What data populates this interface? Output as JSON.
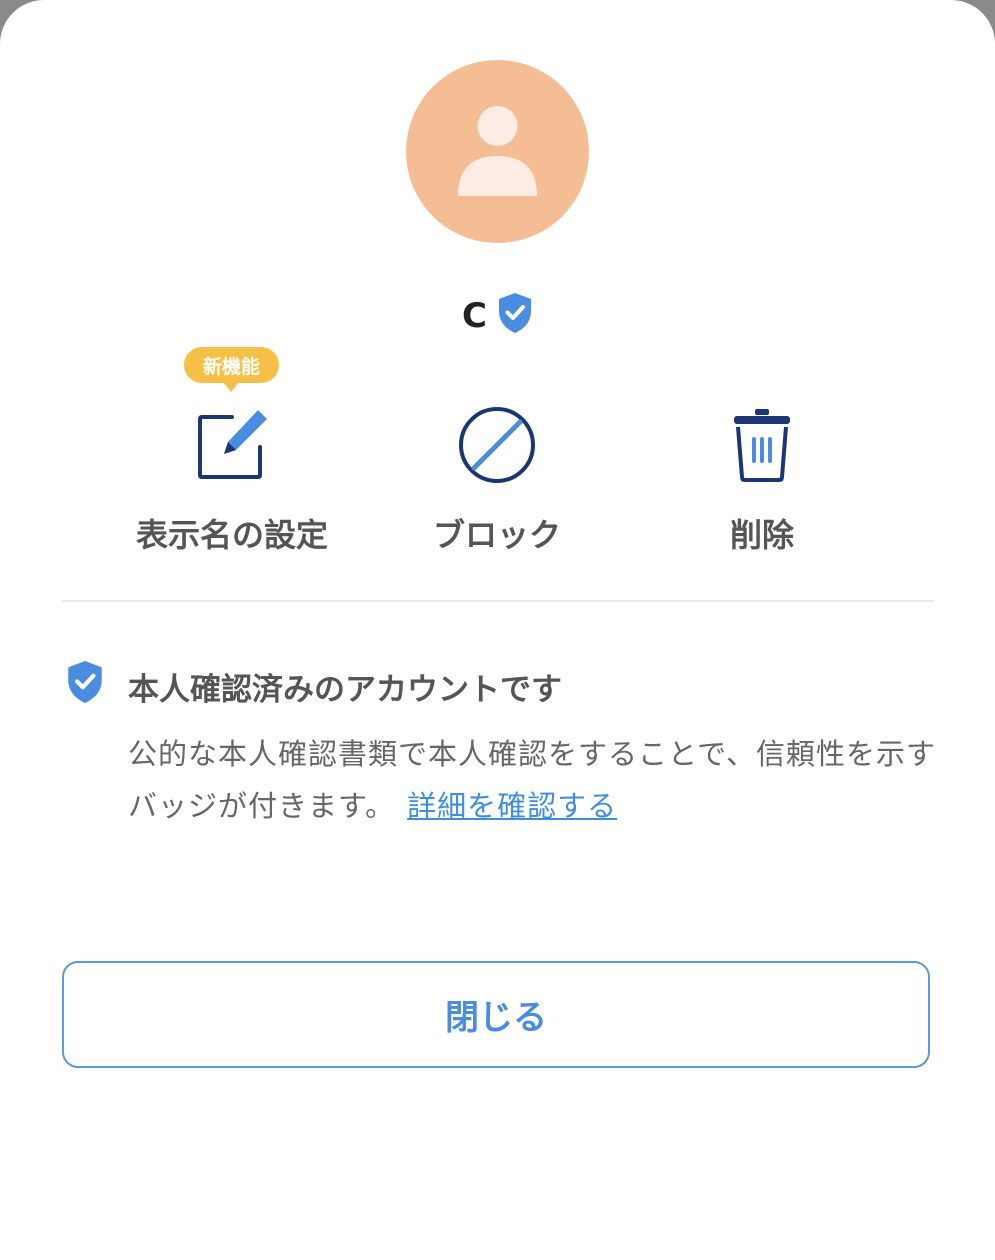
{
  "profile": {
    "name": "C",
    "verified_icon": "verified-shield-icon",
    "avatar_icon": "person-icon",
    "avatar_color": "#f5bd93"
  },
  "actions": [
    {
      "label": "表示名の設定",
      "icon": "edit-icon",
      "badge": "新機能"
    },
    {
      "label": "ブロック",
      "icon": "block-icon"
    },
    {
      "label": "削除",
      "icon": "trash-icon"
    }
  ],
  "verification": {
    "icon": "verified-shield-icon",
    "title": "本人確認済みのアカウントです",
    "description": "公的な本人確認書類で本人確認をすることで、信頼性を示すバッジが付きます。",
    "link": "詳細を確認する"
  },
  "close_button": {
    "label": "閉じる"
  },
  "colors": {
    "accent": "#4a8de0",
    "navy": "#1c3575",
    "badge": "#f5c045",
    "divider": "#e8e8e8"
  }
}
